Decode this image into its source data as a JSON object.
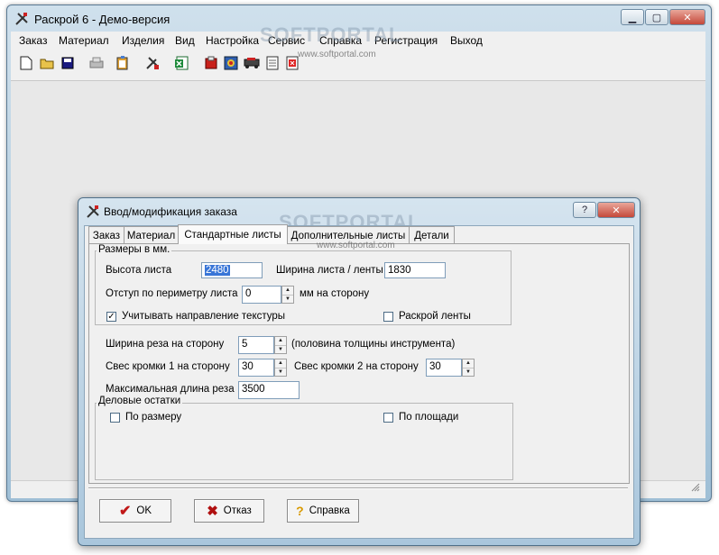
{
  "main_window": {
    "title": "Раскрой 6 - Демо-версия",
    "caption_buttons": {
      "minimize": "▭",
      "maximize": "▢",
      "close": "✕"
    },
    "menu": [
      "Заказ",
      "Материал",
      "Изделия",
      "Вид",
      "Настройка",
      "Сервис",
      "Справка",
      "Регистрация",
      "Выход"
    ],
    "toolbar_icons": [
      "new-file-icon",
      "open-folder-icon",
      "save-icon",
      "print-icon",
      "clipboard-icon",
      "tools-icon",
      "excel-icon",
      "red-book-icon",
      "image-icon",
      "truck-icon",
      "notepad-icon",
      "red-document-icon"
    ]
  },
  "watermark": {
    "logo": "SOFTPORTAL",
    "url": "www.softportal.com"
  },
  "dialog": {
    "title": "Ввод/модификация заказа",
    "help_button": "?",
    "close_button": "✕",
    "tabs": [
      "Заказ",
      "Материал",
      "Стандартные листы",
      "Дополнительные листы",
      "Детали"
    ],
    "selected_tab": "Стандартные листы",
    "sizes_group": {
      "legend": "Размеры в мм.",
      "sheet_height_label": "Высота листа",
      "sheet_height_value": "2480",
      "sheet_width_label": "Ширина листа / ленты",
      "sheet_width_value": "1830",
      "margin_label": "Отступ по периметру листа",
      "margin_value": "0",
      "margin_unit": "мм на сторону",
      "texture_label": "Учитывать направление текстуры",
      "texture_checked": true,
      "tape_cut_label": "Раскрой ленты",
      "tape_cut_checked": false
    },
    "cut_width_label": "Ширина реза на сторону",
    "cut_width_value": "5",
    "cut_width_note": "(половина толщины инструмента)",
    "overhang1_label": "Свес кромки 1 на сторону",
    "overhang1_value": "30",
    "overhang2_label": "Свес кромки 2 на сторону",
    "overhang2_value": "30",
    "max_cut_label": "Максимальная длина реза",
    "max_cut_value": "3500",
    "remnants_group": {
      "legend": "Деловые остатки",
      "by_size_label": "По размеру",
      "by_size_checked": false,
      "by_area_label": "По площади",
      "by_area_checked": false
    },
    "buttons": {
      "ok": "OK",
      "cancel": "Отказ",
      "help": "Справка"
    }
  }
}
